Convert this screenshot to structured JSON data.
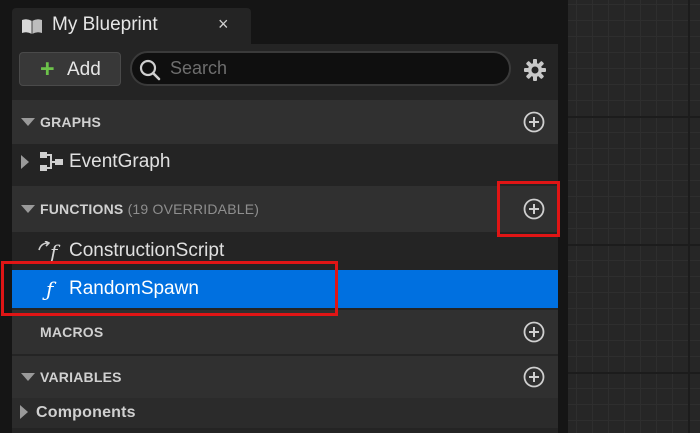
{
  "tab": {
    "title": "My Blueprint",
    "close": "×",
    "icon": "book-icon"
  },
  "toolbar": {
    "add_plus": "+",
    "add_label": "Add",
    "search_placeholder": "Search",
    "search_value": "",
    "settings_icon": "gear-icon"
  },
  "sections": {
    "graphs": {
      "title": "GRAPHS",
      "items": [
        {
          "label": "EventGraph",
          "icon": "event-graph-icon"
        }
      ]
    },
    "functions": {
      "title": "FUNCTIONS",
      "subtitle": "(19 OVERRIDABLE)",
      "items": [
        {
          "label": "ConstructionScript",
          "icon": "construction-script-icon",
          "glyph": "f"
        },
        {
          "label": "RandomSpawn",
          "icon": "function-icon",
          "glyph": "ƒ",
          "selected": true
        }
      ]
    },
    "macros": {
      "title": "MACROS"
    },
    "variables": {
      "title": "VARIABLES",
      "items": [
        {
          "label": "Components"
        }
      ]
    }
  },
  "colors": {
    "selection": "#0070e0",
    "highlight": "#e01515",
    "add_accent": "#6cc24a",
    "panel": "#242424",
    "header": "#303030"
  }
}
